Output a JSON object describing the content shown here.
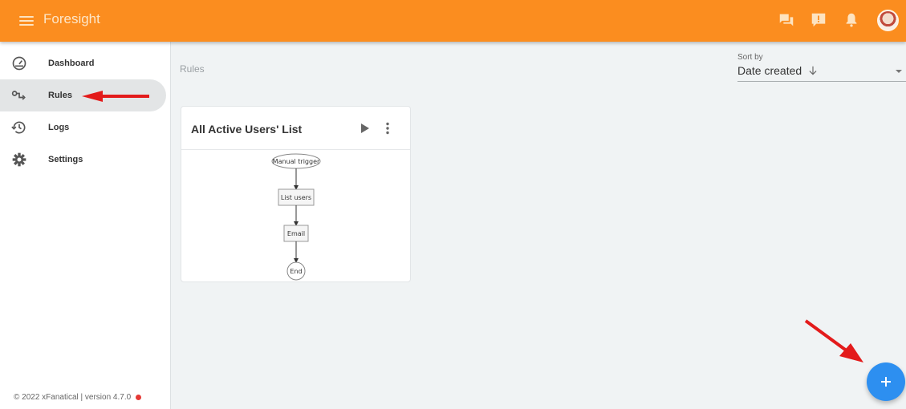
{
  "app": {
    "title": "Foresight",
    "brand_color": "#fb8d1f",
    "header_icons": [
      "feedback-icon",
      "report-icon",
      "notifications-icon",
      "avatar"
    ]
  },
  "sidebar": {
    "items": [
      {
        "label": "Dashboard",
        "icon": "dashboard-gauge-icon",
        "active": false
      },
      {
        "label": "Rules",
        "icon": "rules-icon",
        "active": true
      },
      {
        "label": "Logs",
        "icon": "history-icon",
        "active": false
      },
      {
        "label": "Settings",
        "icon": "gear-icon",
        "active": false
      }
    ],
    "footer": "© 2022 xFanatical | version 4.7.0",
    "status_color": "#e53935"
  },
  "main": {
    "breadcrumb": "Rules",
    "sort": {
      "label": "Sort by",
      "value": "Date created",
      "direction": "descending"
    },
    "cards": [
      {
        "title": "All Active Users' List",
        "flow": [
          "Manual trigger",
          "List users",
          "Email",
          "End"
        ]
      }
    ],
    "fab": {
      "label": "+",
      "color": "#2d8ff0"
    }
  },
  "annotations": {
    "arrow_color": "#e31b1b"
  }
}
